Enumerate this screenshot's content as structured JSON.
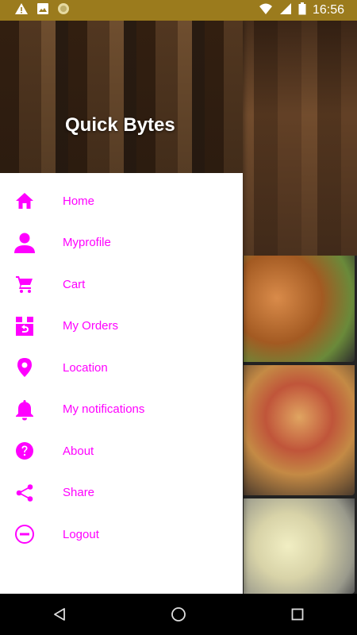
{
  "status_bar": {
    "time": "16:56",
    "icons": [
      "warning-icon",
      "image-icon",
      "record-icon",
      "wifi-icon",
      "signal-icon",
      "battery-icon"
    ]
  },
  "drawer": {
    "title": "Quick Bytes",
    "items": [
      {
        "label": "Home",
        "icon": "home-icon"
      },
      {
        "label": "Myprofile",
        "icon": "person-icon"
      },
      {
        "label": "Cart",
        "icon": "cart-icon"
      },
      {
        "label": "My Orders",
        "icon": "orders-icon"
      },
      {
        "label": "Location",
        "icon": "location-pin-icon"
      },
      {
        "label": "My notifications",
        "icon": "bell-icon"
      },
      {
        "label": "About",
        "icon": "help-icon"
      },
      {
        "label": "Share",
        "icon": "share-icon"
      },
      {
        "label": "Logout",
        "icon": "logout-icon"
      }
    ]
  },
  "colors": {
    "accent": "#ff00ff",
    "status_bar": "#9b7b1d",
    "nav_bar": "#000000"
  },
  "nav_bar": {
    "buttons": [
      "back-icon",
      "home-circle-icon",
      "recents-icon"
    ]
  }
}
